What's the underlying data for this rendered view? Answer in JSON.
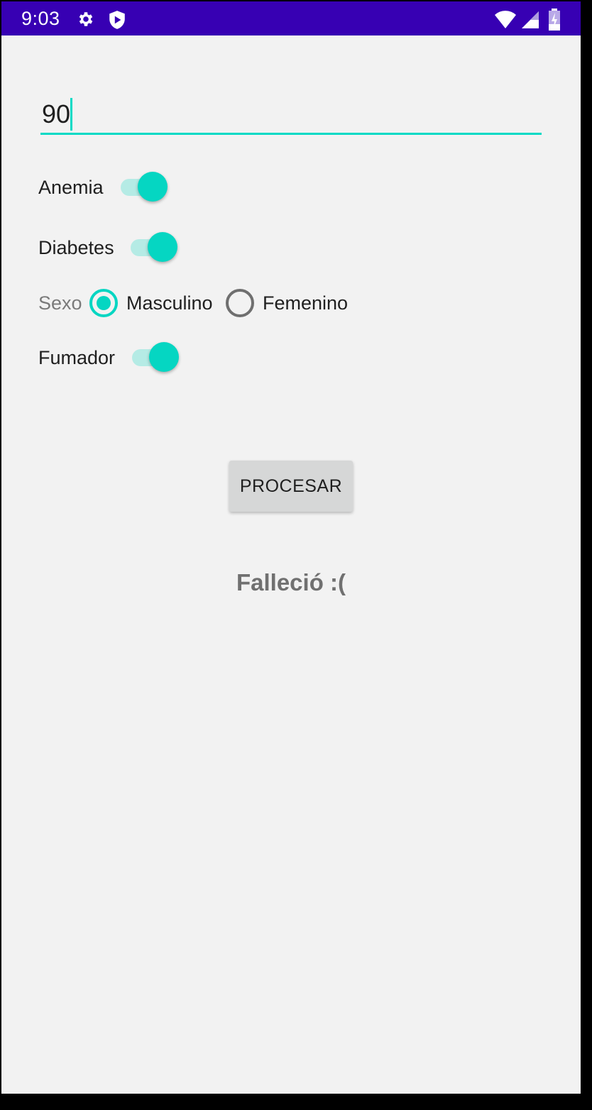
{
  "status_bar": {
    "time": "9:03",
    "icons": [
      "gear-icon",
      "shield-icon",
      "wifi-icon",
      "signal-icon",
      "battery-icon"
    ],
    "background": "#3700b3"
  },
  "form": {
    "age_value": "90",
    "switches": [
      {
        "label": "Anemia",
        "checked": true
      },
      {
        "label": "Diabetes",
        "checked": true
      },
      {
        "label": "Fumador",
        "checked": true
      }
    ],
    "sex": {
      "label": "Sexo",
      "options": [
        {
          "label": "Masculino",
          "selected": true
        },
        {
          "label": "Femenino",
          "selected": false
        }
      ]
    },
    "process_button": "PROCESAR",
    "result": "Falleció :("
  },
  "colors": {
    "accent": "#03dac5",
    "primary_dark": "#3700b3",
    "background": "#f2f2f2",
    "button": "#d6d7d7"
  }
}
